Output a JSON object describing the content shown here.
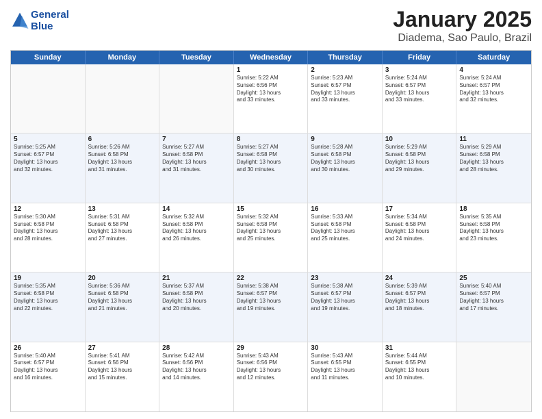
{
  "header": {
    "logo_line1": "General",
    "logo_line2": "Blue",
    "title": "January 2025",
    "subtitle": "Diadema, Sao Paulo, Brazil"
  },
  "weekdays": [
    "Sunday",
    "Monday",
    "Tuesday",
    "Wednesday",
    "Thursday",
    "Friday",
    "Saturday"
  ],
  "weeks": [
    [
      {
        "day": "",
        "info": ""
      },
      {
        "day": "",
        "info": ""
      },
      {
        "day": "",
        "info": ""
      },
      {
        "day": "1",
        "info": "Sunrise: 5:22 AM\nSunset: 6:56 PM\nDaylight: 13 hours\nand 33 minutes."
      },
      {
        "day": "2",
        "info": "Sunrise: 5:23 AM\nSunset: 6:57 PM\nDaylight: 13 hours\nand 33 minutes."
      },
      {
        "day": "3",
        "info": "Sunrise: 5:24 AM\nSunset: 6:57 PM\nDaylight: 13 hours\nand 33 minutes."
      },
      {
        "day": "4",
        "info": "Sunrise: 5:24 AM\nSunset: 6:57 PM\nDaylight: 13 hours\nand 32 minutes."
      }
    ],
    [
      {
        "day": "5",
        "info": "Sunrise: 5:25 AM\nSunset: 6:57 PM\nDaylight: 13 hours\nand 32 minutes."
      },
      {
        "day": "6",
        "info": "Sunrise: 5:26 AM\nSunset: 6:58 PM\nDaylight: 13 hours\nand 31 minutes."
      },
      {
        "day": "7",
        "info": "Sunrise: 5:27 AM\nSunset: 6:58 PM\nDaylight: 13 hours\nand 31 minutes."
      },
      {
        "day": "8",
        "info": "Sunrise: 5:27 AM\nSunset: 6:58 PM\nDaylight: 13 hours\nand 30 minutes."
      },
      {
        "day": "9",
        "info": "Sunrise: 5:28 AM\nSunset: 6:58 PM\nDaylight: 13 hours\nand 30 minutes."
      },
      {
        "day": "10",
        "info": "Sunrise: 5:29 AM\nSunset: 6:58 PM\nDaylight: 13 hours\nand 29 minutes."
      },
      {
        "day": "11",
        "info": "Sunrise: 5:29 AM\nSunset: 6:58 PM\nDaylight: 13 hours\nand 28 minutes."
      }
    ],
    [
      {
        "day": "12",
        "info": "Sunrise: 5:30 AM\nSunset: 6:58 PM\nDaylight: 13 hours\nand 28 minutes."
      },
      {
        "day": "13",
        "info": "Sunrise: 5:31 AM\nSunset: 6:58 PM\nDaylight: 13 hours\nand 27 minutes."
      },
      {
        "day": "14",
        "info": "Sunrise: 5:32 AM\nSunset: 6:58 PM\nDaylight: 13 hours\nand 26 minutes."
      },
      {
        "day": "15",
        "info": "Sunrise: 5:32 AM\nSunset: 6:58 PM\nDaylight: 13 hours\nand 25 minutes."
      },
      {
        "day": "16",
        "info": "Sunrise: 5:33 AM\nSunset: 6:58 PM\nDaylight: 13 hours\nand 25 minutes."
      },
      {
        "day": "17",
        "info": "Sunrise: 5:34 AM\nSunset: 6:58 PM\nDaylight: 13 hours\nand 24 minutes."
      },
      {
        "day": "18",
        "info": "Sunrise: 5:35 AM\nSunset: 6:58 PM\nDaylight: 13 hours\nand 23 minutes."
      }
    ],
    [
      {
        "day": "19",
        "info": "Sunrise: 5:35 AM\nSunset: 6:58 PM\nDaylight: 13 hours\nand 22 minutes."
      },
      {
        "day": "20",
        "info": "Sunrise: 5:36 AM\nSunset: 6:58 PM\nDaylight: 13 hours\nand 21 minutes."
      },
      {
        "day": "21",
        "info": "Sunrise: 5:37 AM\nSunset: 6:58 PM\nDaylight: 13 hours\nand 20 minutes."
      },
      {
        "day": "22",
        "info": "Sunrise: 5:38 AM\nSunset: 6:57 PM\nDaylight: 13 hours\nand 19 minutes."
      },
      {
        "day": "23",
        "info": "Sunrise: 5:38 AM\nSunset: 6:57 PM\nDaylight: 13 hours\nand 19 minutes."
      },
      {
        "day": "24",
        "info": "Sunrise: 5:39 AM\nSunset: 6:57 PM\nDaylight: 13 hours\nand 18 minutes."
      },
      {
        "day": "25",
        "info": "Sunrise: 5:40 AM\nSunset: 6:57 PM\nDaylight: 13 hours\nand 17 minutes."
      }
    ],
    [
      {
        "day": "26",
        "info": "Sunrise: 5:40 AM\nSunset: 6:57 PM\nDaylight: 13 hours\nand 16 minutes."
      },
      {
        "day": "27",
        "info": "Sunrise: 5:41 AM\nSunset: 6:56 PM\nDaylight: 13 hours\nand 15 minutes."
      },
      {
        "day": "28",
        "info": "Sunrise: 5:42 AM\nSunset: 6:56 PM\nDaylight: 13 hours\nand 14 minutes."
      },
      {
        "day": "29",
        "info": "Sunrise: 5:43 AM\nSunset: 6:56 PM\nDaylight: 13 hours\nand 12 minutes."
      },
      {
        "day": "30",
        "info": "Sunrise: 5:43 AM\nSunset: 6:55 PM\nDaylight: 13 hours\nand 11 minutes."
      },
      {
        "day": "31",
        "info": "Sunrise: 5:44 AM\nSunset: 6:55 PM\nDaylight: 13 hours\nand 10 minutes."
      },
      {
        "day": "",
        "info": ""
      }
    ]
  ]
}
